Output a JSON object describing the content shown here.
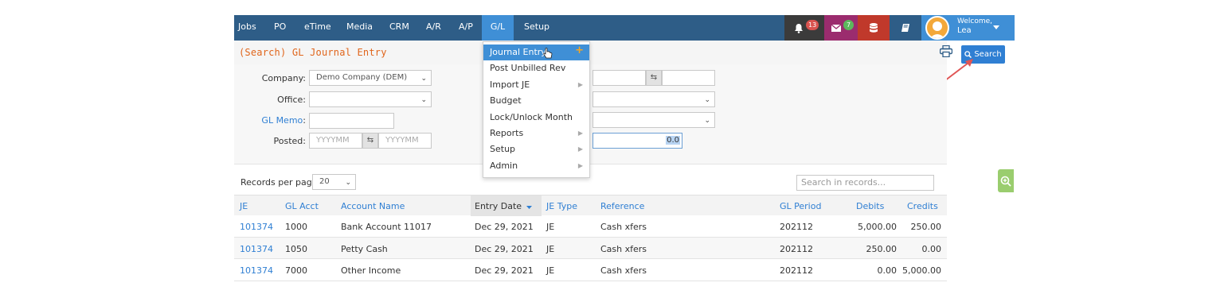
{
  "nav": {
    "items": [
      "Jobs",
      "PO",
      "eTime",
      "Media",
      "CRM",
      "A/R",
      "A/P",
      "G/L",
      "Setup"
    ],
    "active": "G/L",
    "notifications_count": "13",
    "messages_count": "7",
    "welcome_label": "Welcome,",
    "user_name": "Lea"
  },
  "page": {
    "title": "(Search) GL Journal Entry",
    "search_button": "Search"
  },
  "filters": {
    "company_label": "Company:",
    "company_value": "Demo Company (DEM)",
    "office_label": "Office:",
    "office_value": "",
    "gl_memo_label": "GL Memo",
    "gl_memo_colon": ":",
    "gl_memo_value": "",
    "posted_label": "Posted:",
    "posted_from_placeholder": "YYYYMM",
    "posted_to_placeholder": "YYYYMM",
    "amount_value": "0.0"
  },
  "records": {
    "per_page_label": "Records per page:",
    "per_page_value": "20",
    "search_placeholder": "Search in records..."
  },
  "table": {
    "headers": [
      "JE",
      "GL Acct",
      "Account Name",
      "Entry Date",
      "JE Type",
      "Reference",
      "GL Period",
      "Debits",
      "Credits"
    ],
    "rows": [
      {
        "je": "101374",
        "gl_acct": "1000",
        "account_name": "Bank Account 11017",
        "entry_date": "Dec 29, 2021",
        "je_type": "JE",
        "reference": "Cash xfers",
        "gl_period": "202112",
        "debits": "5,000.00",
        "credits": "250.00"
      },
      {
        "je": "101374",
        "gl_acct": "1050",
        "account_name": "Petty Cash",
        "entry_date": "Dec 29, 2021",
        "je_type": "JE",
        "reference": "Cash xfers",
        "gl_period": "202112",
        "debits": "250.00",
        "credits": "0.00"
      },
      {
        "je": "101374",
        "gl_acct": "7000",
        "account_name": "Other Income",
        "entry_date": "Dec 29, 2021",
        "je_type": "JE",
        "reference": "Cash xfers",
        "gl_period": "202112",
        "debits": "0.00",
        "credits": "5,000.00"
      }
    ]
  },
  "gl_menu": {
    "items": [
      "Journal Entry",
      "Post Unbilled Rev",
      "Import JE",
      "Budget",
      "Lock/Unlock Month",
      "Reports",
      "Setup",
      "Admin"
    ]
  },
  "colors": {
    "nav_bg": "#2e5d87",
    "nav_active": "#3f8fd6",
    "accent": "#2f7fd3",
    "title_orange": "#e0651b",
    "bell_badge": "#d9534f",
    "mail_bg": "#9b2c6e",
    "db_bg": "#c0392b"
  },
  "icons": [
    "bell-icon",
    "envelope-icon",
    "database-icon",
    "book-icon",
    "user-avatar-icon",
    "caret-down-icon",
    "print-icon",
    "search-icon",
    "swap-icon",
    "zoom-in-icon",
    "hand-cursor-icon",
    "plus-icon"
  ]
}
